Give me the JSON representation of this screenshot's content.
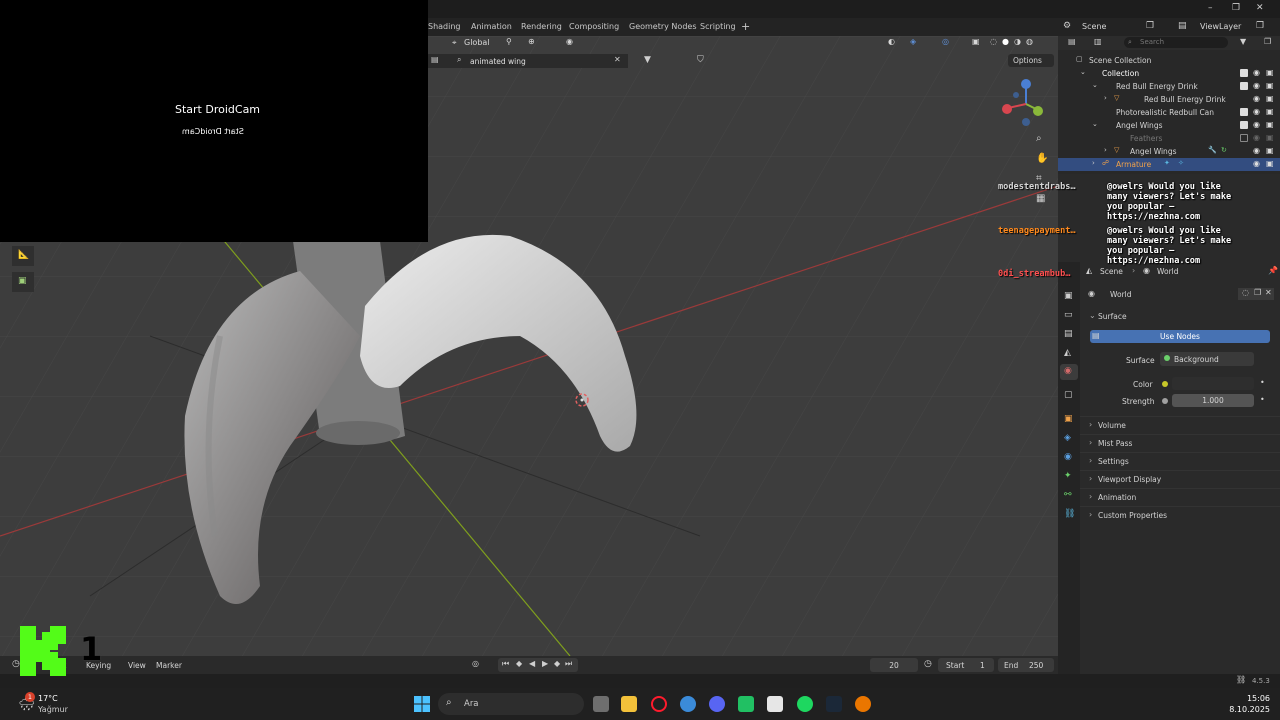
{
  "workspace_tabs": [
    "Shading",
    "Animation",
    "Rendering",
    "Compositing",
    "Geometry Nodes",
    "Scripting"
  ],
  "scene_label": "Scene",
  "viewlayer_label": "ViewLayer",
  "viewport": {
    "orientation": "Global",
    "search_value": "animated wing",
    "options_label": "Options",
    "gizmo_axes": [
      "Z",
      "Y",
      "X"
    ]
  },
  "webcam": {
    "title": "Start DroidCam",
    "mirrored": "Start DroidCam"
  },
  "outliner": {
    "search_placeholder": "Search",
    "rows": [
      {
        "label": "Scene Collection"
      },
      {
        "label": "Collection"
      },
      {
        "label": "Red Bull Energy Drink"
      },
      {
        "label": "Red Bull Energy Drink"
      },
      {
        "label": "Photorealistic Redbull Can"
      },
      {
        "label": "Angel Wings"
      },
      {
        "label": "Feathers"
      },
      {
        "label": "Angel Wings"
      },
      {
        "label": "Armature"
      }
    ]
  },
  "chat": [
    {
      "user": "modestentdrabs…",
      "user_color": "#e8e8e8",
      "message": "@owelrs Would you like\nmany viewers? Let's make\nyou popular –\nhttps://nezhna.com"
    },
    {
      "user": "teenagepayment…",
      "user_color": "#ff8a1e",
      "message": "@owelrs Would you like\nmany viewers? Let's make\nyou popular –\nhttps://nezhna.com"
    },
    {
      "user": "0di_streambub…",
      "user_color": "#ff5050",
      "message": ""
    }
  ],
  "properties": {
    "breadcrumb_scene": "Scene",
    "breadcrumb_world": "World",
    "world_name": "World",
    "surface_header": "Surface",
    "use_nodes_label": "Use Nodes",
    "surface_label": "Surface",
    "surface_value": "Background",
    "color_label": "Color",
    "strength_label": "Strength",
    "strength_value": "1.000",
    "collapsed_panels": [
      "Volume",
      "Mist Pass",
      "Settings",
      "Viewport Display",
      "Animation",
      "Custom Properties"
    ]
  },
  "timeline": {
    "menus": [
      "k",
      "Keying",
      "View",
      "Marker"
    ],
    "current_frame": "20",
    "start_label": "Start",
    "start_value": "1",
    "end_label": "End",
    "end_value": "250"
  },
  "status": {
    "version": "4.5.3"
  },
  "taskbar": {
    "weather_temp": "17°C",
    "weather_desc": "Yağmur",
    "search_placeholder": "Ara",
    "time": "15:06",
    "date": "8.10.2025",
    "badge_count": "1"
  },
  "overlay_logo_digit": "1",
  "colors": {
    "accent_blue": "#4772b3",
    "selection": "#334d80",
    "kick_green": "#53fc18",
    "x_axis": "#b33a3a",
    "y_axis": "#7fa31d"
  }
}
